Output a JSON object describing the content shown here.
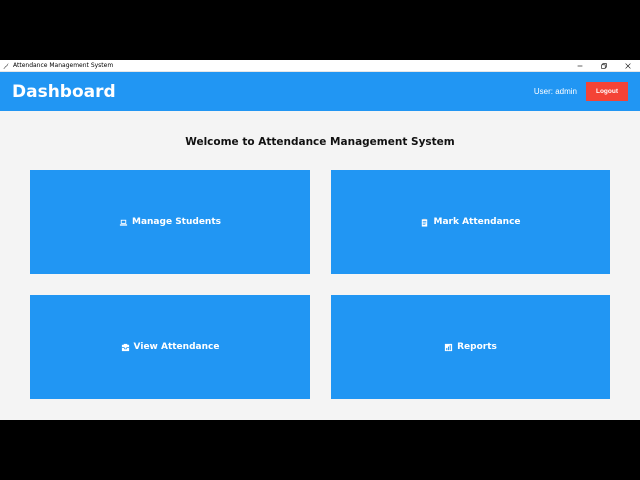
{
  "window": {
    "title": "Attendance Management System"
  },
  "header": {
    "title": "Dashboard",
    "user_label": "User: admin",
    "logout_label": "Logout"
  },
  "main": {
    "welcome": "Welcome to Attendance Management System",
    "cards": [
      {
        "label": "Manage Students",
        "icon": "laptop-icon"
      },
      {
        "label": "Mark Attendance",
        "icon": "clipboard-icon"
      },
      {
        "label": "View Attendance",
        "icon": "inbox-icon"
      },
      {
        "label": "Reports",
        "icon": "chart-icon"
      }
    ]
  },
  "colors": {
    "primary": "#2196f3",
    "danger": "#f44336",
    "background": "#f4f4f4"
  }
}
